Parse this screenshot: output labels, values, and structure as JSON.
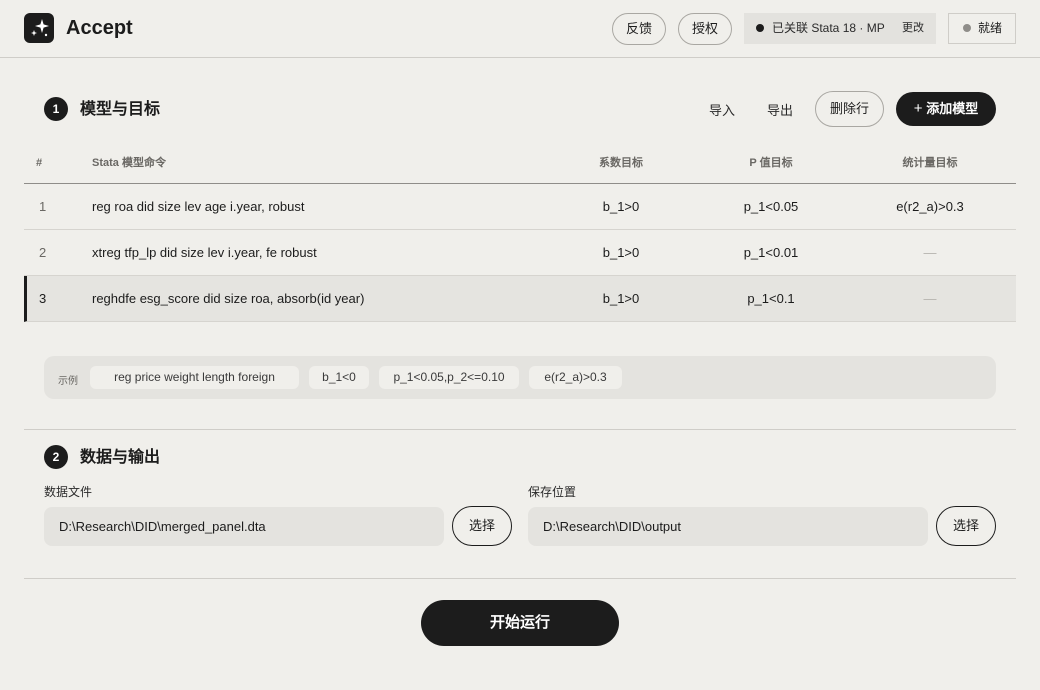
{
  "header": {
    "app_title": "Accept",
    "feedback_label": "反馈",
    "license_label": "授权",
    "stata_status": "已关联 Stata 18 · MP",
    "change_label": "更改",
    "ready_status": "就绪"
  },
  "section1": {
    "number": "1",
    "title": "模型与目标",
    "import_label": "导入",
    "export_label": "导出",
    "delete_row_label": "删除行",
    "add_model_label": "添加模型",
    "columns": [
      "#",
      "Stata 模型命令",
      "系数目标",
      "P 值目标",
      "统计量目标"
    ],
    "rows": [
      {
        "num": "1",
        "command": "reg roa did size lev age i.year, robust",
        "coef": "b_1>0",
        "pval": "p_1<0.05",
        "stat": "e(r2_a)>0.3"
      },
      {
        "num": "2",
        "command": "xtreg tfp_lp did size lev i.year, fe robust",
        "coef": "b_1>0",
        "pval": "p_1<0.01",
        "stat": "—"
      },
      {
        "num": "3",
        "command": "reghdfe esg_score did size roa, absorb(id year)",
        "coef": "b_1>0",
        "pval": "p_1<0.1",
        "stat": "—"
      }
    ],
    "examples_label": "示例",
    "examples": [
      "reg price weight length foreign",
      "b_1<0",
      "p_1<0.05,p_2<=0.10",
      "e(r2_a)>0.3"
    ]
  },
  "section2": {
    "number": "2",
    "title": "数据与输出",
    "data_file_label": "数据文件",
    "data_file_value": "D:\\Research\\DID\\merged_panel.dta",
    "save_location_label": "保存位置",
    "save_location_value": "D:\\Research\\DID\\output",
    "choose_label": "选择"
  },
  "run_label": "开始运行",
  "colors": {
    "dark": "#1c1c1c",
    "background": "#f0efeb",
    "field": "#e4e3df"
  }
}
